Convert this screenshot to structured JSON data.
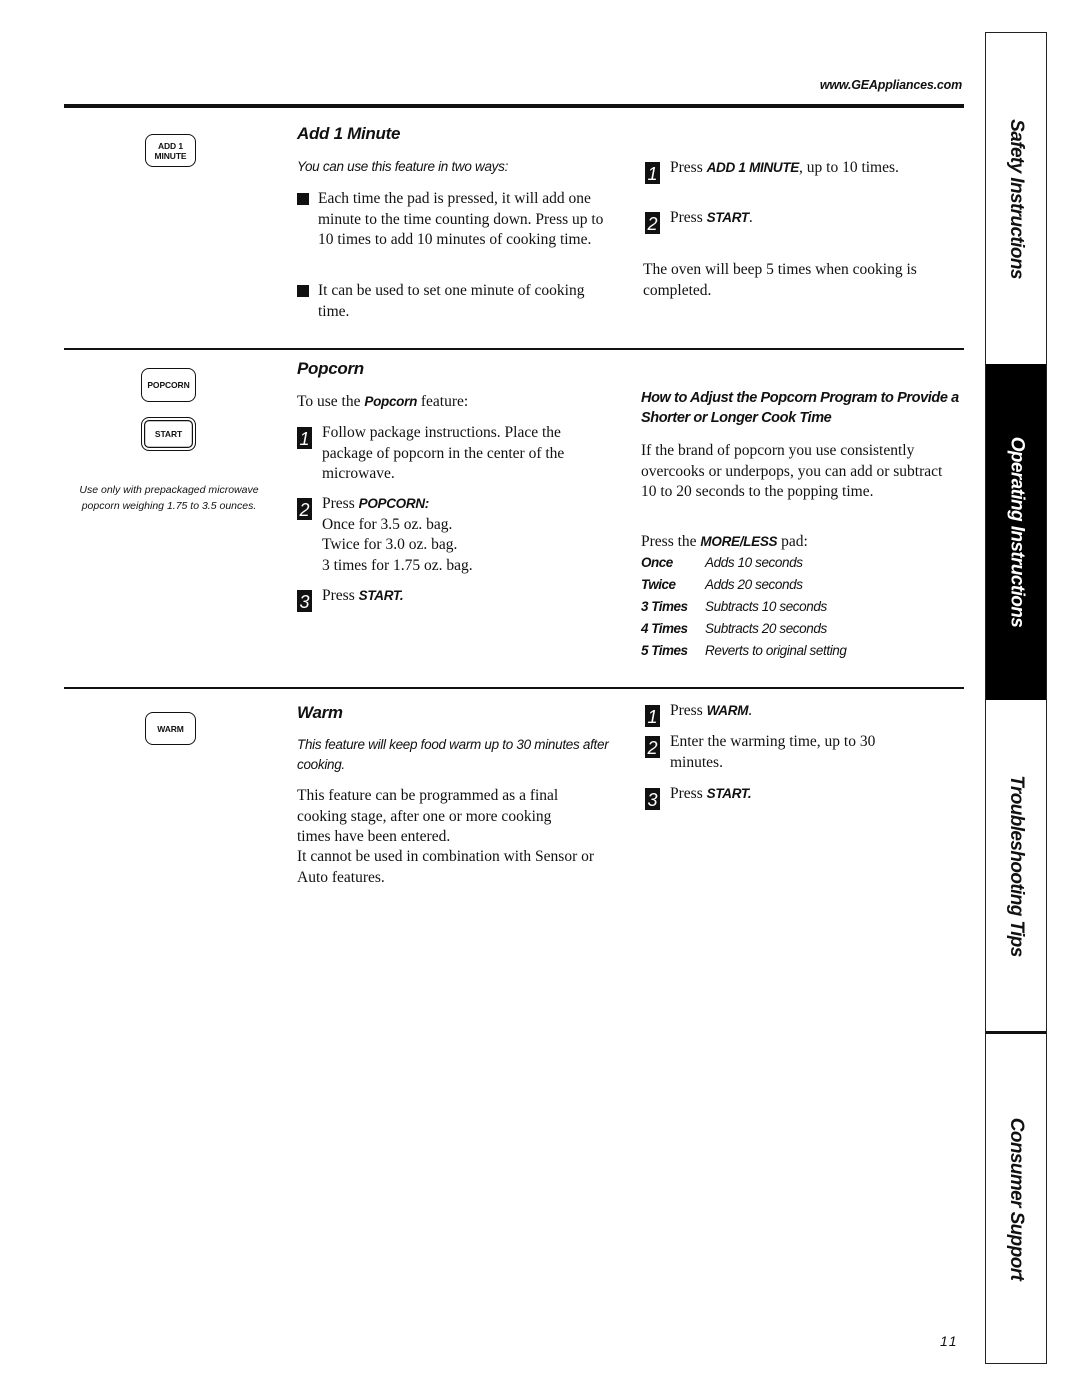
{
  "header": {
    "url": "www.GEAppliances.com"
  },
  "sections": {
    "add1": {
      "pad_line1": "ADD 1",
      "pad_line2": "MINUTE",
      "title": "Add 1 Minute",
      "intro": "You can use this feature in two ways:",
      "bullets": [
        "Each time the pad is pressed, it will add one minute to the time counting down. Press up to 10 times to add 10 minutes of cooking time.",
        "It can be used to set one minute of cooking time."
      ],
      "steps": [
        {
          "num": "1",
          "pre": "Press ",
          "kw": "ADD 1 MINUTE",
          "post": ", up to 10 times."
        },
        {
          "num": "2",
          "pre": "Press ",
          "kw": "START",
          "post": "."
        }
      ],
      "note": "The oven will beep 5 times when cooking is completed."
    },
    "popcorn": {
      "pad_popcorn": "POPCORN",
      "pad_start": "START",
      "side_note": "Use only with prepackaged microwave popcorn weighing 1.75 to 3.5 ounces.",
      "title": "Popcorn",
      "intro_pre": "To use the ",
      "intro_kw": "Popcorn",
      "intro_post": " feature:",
      "step1": {
        "num": "1",
        "text": "Follow package instructions. Place the package of popcorn in the center of the microwave."
      },
      "step2": {
        "num": "2",
        "pre": "Press ",
        "kw": "POPCORN:",
        "lines": [
          "Once for 3.5 oz. bag.",
          "Twice for 3.0 oz. bag.",
          "3 times for 1.75 oz. bag."
        ]
      },
      "step3": {
        "num": "3",
        "pre": "Press ",
        "kw": "START."
      },
      "adjust": {
        "title": "How to Adjust the Popcorn Program to Provide a Shorter or Longer Cook Time",
        "body": "If the brand of popcorn you use consistently overcooks or underpops, you can add or subtract 10 to 20 seconds to the popping time.",
        "press_pre": "Press the ",
        "press_kw": "MORE/LESS",
        "press_post": " pad:",
        "rows": [
          {
            "times": "Once",
            "effect": "Adds 10 seconds"
          },
          {
            "times": "Twice",
            "effect": "Adds 20 seconds"
          },
          {
            "times": "3 Times",
            "effect": "Subtracts 10 seconds"
          },
          {
            "times": "4 Times",
            "effect": "Subtracts 20 seconds"
          },
          {
            "times": "5 Times",
            "effect": "Reverts to original setting"
          }
        ]
      }
    },
    "warm": {
      "pad": "WARM",
      "title": "Warm",
      "intro": "This feature will keep food warm up to 30 minutes after cooking.",
      "body1": "This feature can be programmed as a final cooking stage, after one or more cooking times have been entered.",
      "body2": "It cannot be used in combination with Sensor or Auto features.",
      "steps": [
        {
          "num": "1",
          "pre": "Press ",
          "kw": "WARM",
          "post": "."
        },
        {
          "num": "2",
          "pre": "Enter the warming time, up to 30 minutes.",
          "kw": "",
          "post": ""
        },
        {
          "num": "3",
          "pre": "Press ",
          "kw": "START.",
          "post": ""
        }
      ]
    }
  },
  "sidebar": {
    "tabs": [
      {
        "label": "Safety Instructions",
        "active": false
      },
      {
        "label": "Operating Instructions",
        "active": true
      },
      {
        "label": "Troubleshooting Tips",
        "active": false
      },
      {
        "label": "Consumer Support",
        "active": false
      }
    ]
  },
  "footer": {
    "page_number": "11"
  }
}
